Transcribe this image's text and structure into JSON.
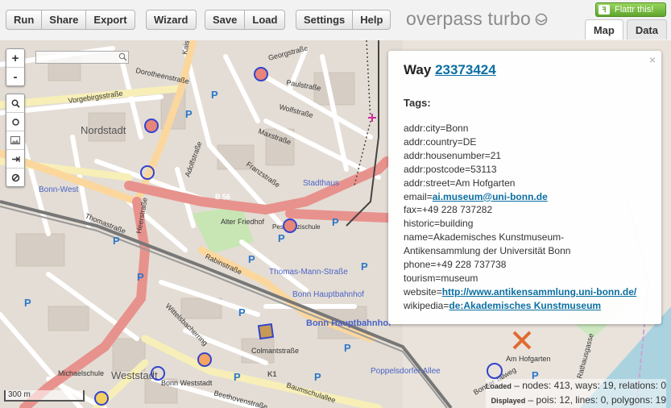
{
  "toolbar": {
    "run": "Run",
    "share": "Share",
    "export": "Export",
    "wizard": "Wizard",
    "save": "Save",
    "load": "Load",
    "settings": "Settings",
    "help": "Help"
  },
  "app_title": "overpass turbo",
  "flattr": "Flattr this!",
  "tabs": {
    "map": "Map",
    "data": "Data"
  },
  "map": {
    "zoom_in": "+",
    "zoom_out": "-",
    "search_placeholder": "",
    "scale": "300 m",
    "labels": [
      "Vorgebirgsstraße",
      "Nordstadt",
      "Bonn-West",
      "Thomastraße",
      "Alter Friedhof",
      "Stadthaus",
      "Thomas-Mann-Straße",
      "Bonn Hauptbahnhof",
      "Bonn Hauptbahnhof",
      "Weststadt",
      "Bonn Weststadt",
      "Michaelschule",
      "Poppelsdorfer Allee",
      "Baumschulallee",
      "Colmantstraße",
      "Wittelsbacherring",
      "Rabinstraße",
      "Heerstraße",
      "Dorotheenstraße",
      "Georgstraße",
      "Paulstraße",
      "Wolfstraße",
      "Maxstraße",
      "Franzstraße",
      "Pestalozzischule",
      "Am Hofgarten",
      "B 56",
      "K1",
      "Kaiserstraße",
      "Beethovenstraße",
      "Adolfstraße",
      "Bonner Talweg",
      "Rathausgasse"
    ]
  },
  "popup": {
    "close": "×",
    "title_prefix": "Way",
    "way_id": "23373424",
    "tags_heading": "Tags:",
    "tags": [
      {
        "key": "addr:city",
        "value": "Bonn"
      },
      {
        "key": "addr:country",
        "value": "DE"
      },
      {
        "key": "addr:housenumber",
        "value": "21"
      },
      {
        "key": "addr:postcode",
        "value": "53113"
      },
      {
        "key": "addr:street",
        "value": "Am Hofgarten"
      },
      {
        "key": "email",
        "value": "ai.museum@uni-bonn.de",
        "link": true
      },
      {
        "key": "fax",
        "value": "+49 228 737282"
      },
      {
        "key": "historic",
        "value": "building"
      },
      {
        "key": "name",
        "value": "Akademisches Kunstmuseum-",
        "cont": "Antikensammlung der Universität Bonn"
      },
      {
        "key": "phone",
        "value": "+49 228 737738"
      },
      {
        "key": "tourism",
        "value": "museum"
      },
      {
        "key": "website",
        "value": "http://www.antikensammlung.uni-bonn.de/",
        "link": true
      },
      {
        "key": "wikipedia",
        "value": "de:Akademisches Kunstmuseum",
        "link": true
      }
    ]
  },
  "stats": {
    "loaded_label": "Loaded",
    "loaded": "– nodes: 413, ways: 19, relations: 0",
    "displayed_label": "Displayed",
    "displayed": "– pois: 12, lines: 0, polygons: 19"
  },
  "colors": {
    "accent": "#0b6fa1",
    "poi_stroke": "#3344cc",
    "poi_fill": "#e8857a"
  }
}
